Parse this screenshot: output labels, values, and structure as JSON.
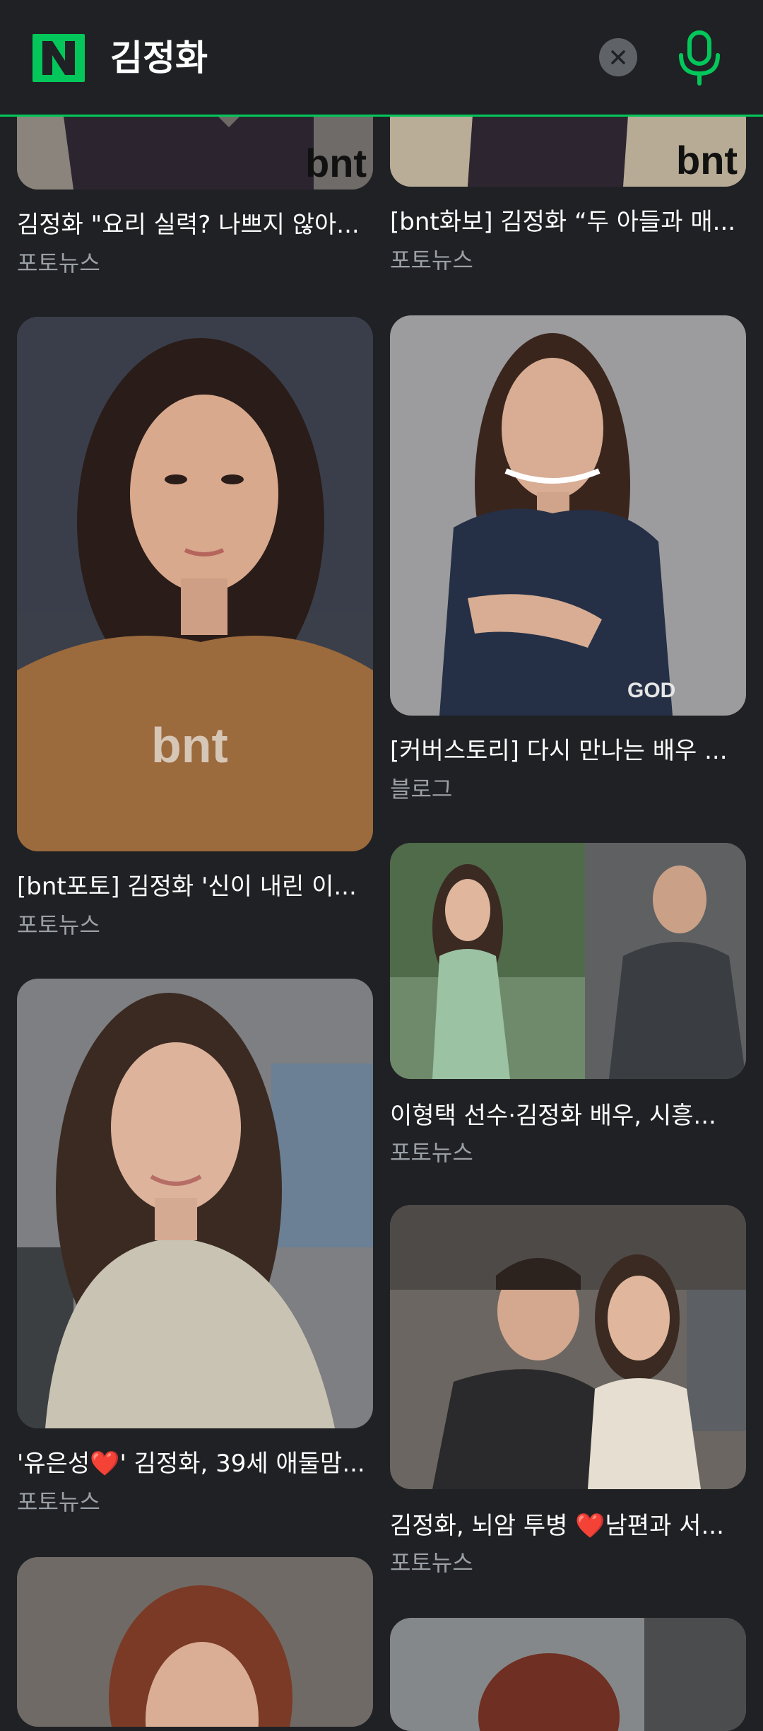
{
  "search": {
    "query": "김정화"
  },
  "colors": {
    "brand": "#03c75a",
    "background": "#202124",
    "title": "#ffffff",
    "source": "#9aa0a6"
  },
  "results": [
    {
      "title": "김정화 \"요리 실력? 나쁘지 않아...",
      "source": "포토뉴스",
      "watermark": "bnt"
    },
    {
      "title": "[bnt화보] 김정화 “두 아들과 매...",
      "source": "포토뉴스",
      "watermark": "bnt"
    },
    {
      "title": "[bnt포토] 김정화 '신이 내린 이...",
      "source": "포토뉴스",
      "watermark": "bnt"
    },
    {
      "title": "[커버스토리] 다시 만나는 배우 ...",
      "source": "블로그",
      "watermark": "GOD"
    },
    {
      "title": "이형택 선수·김정화 배우, 시흥...",
      "source": "포토뉴스"
    },
    {
      "title": "'유은성❤️' 김정화, 39세 애둘맘...",
      "source": "포토뉴스"
    },
    {
      "title": "김정화, 뇌암 투병 ❤️남편과 서...",
      "source": "포토뉴스"
    }
  ]
}
